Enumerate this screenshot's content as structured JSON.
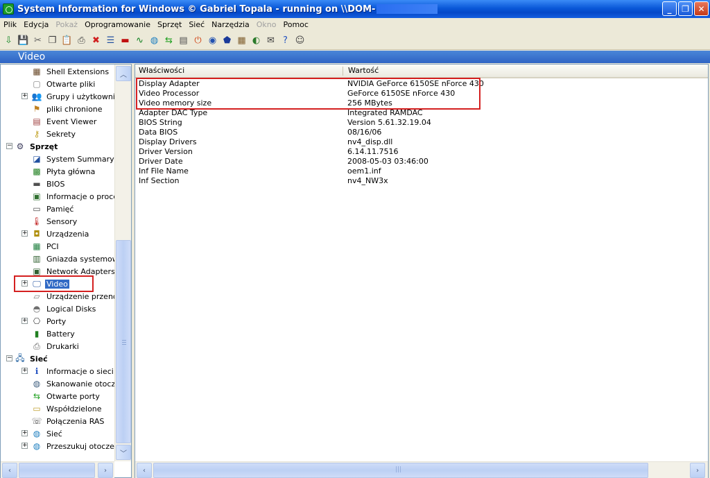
{
  "window": {
    "title": "System Information for Windows  © Gabriel Topala - running on \\\\DOM-",
    "controls": [
      "_",
      "❐",
      "✕"
    ]
  },
  "menu": [
    {
      "label": "Plik",
      "enabled": true
    },
    {
      "label": "Edycja",
      "enabled": true
    },
    {
      "label": "Pokaż",
      "enabled": false
    },
    {
      "label": "Oprogramowanie",
      "enabled": true
    },
    {
      "label": "Sprzęt",
      "enabled": true
    },
    {
      "label": "Sieć",
      "enabled": true
    },
    {
      "label": "Narzędzia",
      "enabled": true
    },
    {
      "label": "Okno",
      "enabled": false
    },
    {
      "label": "Pomoc",
      "enabled": true
    }
  ],
  "toolbar": [
    {
      "name": "refresh-icon",
      "glyph": "⇩",
      "color": "#1a8a2a"
    },
    {
      "name": "save-icon",
      "glyph": "💾",
      "color": "#203060"
    },
    {
      "name": "cut-icon",
      "glyph": "✂",
      "color": "#606060"
    },
    {
      "name": "copy-icon",
      "glyph": "❐",
      "color": "#404040"
    },
    {
      "name": "paste-icon",
      "glyph": "📋",
      "color": "#806020"
    },
    {
      "name": "print-icon",
      "glyph": "⎙",
      "color": "#404040"
    },
    {
      "name": "stop-icon",
      "glyph": "✖",
      "color": "#d02020"
    },
    {
      "name": "report-icon",
      "glyph": "☰",
      "color": "#2050a0"
    },
    {
      "name": "flag-icon",
      "glyph": "▬",
      "color": "#c01010"
    },
    {
      "name": "chart-icon",
      "glyph": "∿",
      "color": "#108020"
    },
    {
      "name": "globe-icon",
      "glyph": "◍",
      "color": "#2080c0"
    },
    {
      "name": "arrows-icon",
      "glyph": "⇆",
      "color": "#20a020"
    },
    {
      "name": "document-icon",
      "glyph": "▤",
      "color": "#505050"
    },
    {
      "name": "power-icon",
      "glyph": "⏻",
      "color": "#d04010"
    },
    {
      "name": "sync-icon",
      "glyph": "◉",
      "color": "#2050b0"
    },
    {
      "name": "shield-icon",
      "glyph": "⬟",
      "color": "#1a3a9a"
    },
    {
      "name": "grid-icon",
      "glyph": "▦",
      "color": "#806030"
    },
    {
      "name": "drive-icon",
      "glyph": "◐",
      "color": "#2a7a2a"
    },
    {
      "name": "mail-icon",
      "glyph": "✉",
      "color": "#404040"
    },
    {
      "name": "help-icon",
      "glyph": "?",
      "color": "#2050c0"
    },
    {
      "name": "user-icon",
      "glyph": "☺",
      "color": "#404040"
    }
  ],
  "section_title": "Video",
  "tree": [
    {
      "label": "Shell Extensions",
      "icon": "▦",
      "color": "#6a4a2a",
      "indent": 1,
      "expander": "",
      "bold": false
    },
    {
      "label": "Otwarte pliki",
      "icon": "▢",
      "color": "#808080",
      "indent": 1,
      "expander": "",
      "bold": false
    },
    {
      "label": "Grupy i użytkownicy",
      "icon": "👥",
      "color": "#406040",
      "indent": 1,
      "expander": "+",
      "bold": false
    },
    {
      "label": "pliki chronione",
      "icon": "⚑",
      "color": "#c08020",
      "indent": 1,
      "expander": "",
      "bold": false
    },
    {
      "label": "Event Viewer",
      "icon": "▤",
      "color": "#a04040",
      "indent": 1,
      "expander": "",
      "bold": false
    },
    {
      "label": "Sekrety",
      "icon": "⚷",
      "color": "#c0a020",
      "indent": 1,
      "expander": "",
      "bold": false
    },
    {
      "label": "Sprzęt",
      "icon": "⚙",
      "color": "#404060",
      "indent": 0,
      "expander": "−",
      "bold": true
    },
    {
      "label": "System Summary",
      "icon": "◪",
      "color": "#2050a0",
      "indent": 1,
      "expander": "",
      "bold": false
    },
    {
      "label": "Płyta główna",
      "icon": "▩",
      "color": "#208020",
      "indent": 1,
      "expander": "",
      "bold": false
    },
    {
      "label": "BIOS",
      "icon": "▬",
      "color": "#505050",
      "indent": 1,
      "expander": "",
      "bold": false
    },
    {
      "label": "Informacje o procesorze",
      "icon": "▣",
      "color": "#307030",
      "indent": 1,
      "expander": "",
      "bold": false
    },
    {
      "label": "Pamięć",
      "icon": "▭",
      "color": "#505050",
      "indent": 1,
      "expander": "",
      "bold": false
    },
    {
      "label": "Sensory",
      "icon": "🌡",
      "color": "#c02020",
      "indent": 1,
      "expander": "",
      "bold": false
    },
    {
      "label": "Urządzenia",
      "icon": "◘",
      "color": "#b09010",
      "indent": 1,
      "expander": "+",
      "bold": false
    },
    {
      "label": "PCI",
      "icon": "▦",
      "color": "#208040",
      "indent": 1,
      "expander": "",
      "bold": false
    },
    {
      "label": "Gniazda systemowe",
      "icon": "▥",
      "color": "#306030",
      "indent": 1,
      "expander": "",
      "bold": false
    },
    {
      "label": "Network Adapters",
      "icon": "▣",
      "color": "#306030",
      "indent": 1,
      "expander": "",
      "bold": false
    },
    {
      "label": "Video",
      "icon": "🖵",
      "color": "#2050a0",
      "indent": 1,
      "expander": "+",
      "bold": false,
      "selected": true
    },
    {
      "label": "Urządzenie przenośne",
      "icon": "▱",
      "color": "#808080",
      "indent": 1,
      "expander": "",
      "bold": false
    },
    {
      "label": "Logical Disks",
      "icon": "◓",
      "color": "#707070",
      "indent": 1,
      "expander": "",
      "bold": false
    },
    {
      "label": "Porty",
      "icon": "⎔",
      "color": "#404040",
      "indent": 1,
      "expander": "+",
      "bold": false
    },
    {
      "label": "Battery",
      "icon": "▮",
      "color": "#208020",
      "indent": 1,
      "expander": "",
      "bold": false
    },
    {
      "label": "Drukarki",
      "icon": "⎙",
      "color": "#606060",
      "indent": 1,
      "expander": "",
      "bold": false
    },
    {
      "label": "Sieć",
      "icon": "🖧",
      "color": "#2060a0",
      "indent": 0,
      "expander": "−",
      "bold": true
    },
    {
      "label": "Informacje o sieci",
      "icon": "ℹ",
      "color": "#2050c0",
      "indent": 1,
      "expander": "+",
      "bold": false
    },
    {
      "label": "Skanowanie otoczenia",
      "icon": "◍",
      "color": "#406080",
      "indent": 1,
      "expander": "",
      "bold": false
    },
    {
      "label": "Otwarte porty",
      "icon": "⇆",
      "color": "#20a020",
      "indent": 1,
      "expander": "",
      "bold": false
    },
    {
      "label": "Współdzielone",
      "icon": "▭",
      "color": "#c0a030",
      "indent": 1,
      "expander": "",
      "bold": false
    },
    {
      "label": "Połączenia RAS",
      "icon": "☏",
      "color": "#505050",
      "indent": 1,
      "expander": "",
      "bold": false
    },
    {
      "label": "Sieć",
      "icon": "◍",
      "color": "#2080c0",
      "indent": 1,
      "expander": "+",
      "bold": false
    },
    {
      "label": "Przeszukuj otoczenie",
      "icon": "◍",
      "color": "#2080c0",
      "indent": 1,
      "expander": "+",
      "bold": false
    }
  ],
  "list": {
    "columns": [
      "Właściwości",
      "Wartość"
    ],
    "rows": [
      {
        "property": "Display Adapter",
        "value": "NVIDIA GeForce 6150SE nForce 430"
      },
      {
        "property": "Video Processor",
        "value": "GeForce 6150SE nForce 430"
      },
      {
        "property": "Video memory size",
        "value": "256 MBytes"
      },
      {
        "property": "Adapter DAC Type",
        "value": "Integrated RAMDAC"
      },
      {
        "property": "BIOS String",
        "value": "Version 5.61.32.19.04"
      },
      {
        "property": "Data BIOS",
        "value": "08/16/06"
      },
      {
        "property": "Display Drivers",
        "value": "nv4_disp.dll"
      },
      {
        "property": "Driver Version",
        "value": "6.14.11.7516"
      },
      {
        "property": "Driver Date",
        "value": "2008-05-03 03:46:00"
      },
      {
        "property": "Inf File Name",
        "value": "oem1.inf"
      },
      {
        "property": "Inf Section",
        "value": "nv4_NW3x"
      }
    ]
  },
  "scroll_glyphs": {
    "up": "︿",
    "down": "﹀",
    "left": "‹",
    "right": "›",
    "grip": "≡",
    "hgrip": "|||"
  }
}
